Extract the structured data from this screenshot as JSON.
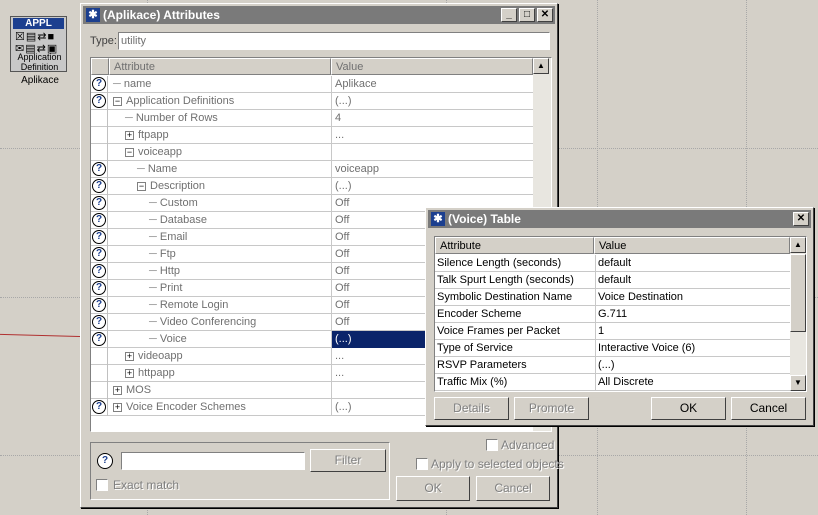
{
  "desktop": {
    "node": {
      "badge": "APPL",
      "line1": "Application",
      "line2": "Definition",
      "caption": "Aplikace"
    }
  },
  "attributes_window": {
    "title": "(Aplikace) Attributes",
    "type_label": "Type:",
    "type_value": "utility",
    "columns": {
      "attribute": "Attribute",
      "value": "Value"
    },
    "rows": [
      {
        "label": "name",
        "value": "Aplikace",
        "help": true,
        "indent": 0,
        "expander": ""
      },
      {
        "label": "Application Definitions",
        "value": "(...)",
        "help": true,
        "indent": 0,
        "expander": "−"
      },
      {
        "label": "Number of Rows",
        "value": "4",
        "help": false,
        "indent": 1,
        "expander": ""
      },
      {
        "label": "ftpapp",
        "value": "...",
        "help": false,
        "indent": 1,
        "expander": "+"
      },
      {
        "label": "voiceapp",
        "value": "",
        "help": false,
        "indent": 1,
        "expander": "−"
      },
      {
        "label": "Name",
        "value": "voiceapp",
        "help": true,
        "indent": 2,
        "expander": ""
      },
      {
        "label": "Description",
        "value": "(...)",
        "help": true,
        "indent": 2,
        "expander": "−"
      },
      {
        "label": "Custom",
        "value": "Off",
        "help": true,
        "indent": 3,
        "expander": ""
      },
      {
        "label": "Database",
        "value": "Off",
        "help": true,
        "indent": 3,
        "expander": ""
      },
      {
        "label": "Email",
        "value": "Off",
        "help": true,
        "indent": 3,
        "expander": ""
      },
      {
        "label": "Ftp",
        "value": "Off",
        "help": true,
        "indent": 3,
        "expander": ""
      },
      {
        "label": "Http",
        "value": "Off",
        "help": true,
        "indent": 3,
        "expander": ""
      },
      {
        "label": "Print",
        "value": "Off",
        "help": true,
        "indent": 3,
        "expander": ""
      },
      {
        "label": "Remote Login",
        "value": "Off",
        "help": true,
        "indent": 3,
        "expander": ""
      },
      {
        "label": "Video Conferencing",
        "value": "Off",
        "help": true,
        "indent": 3,
        "expander": ""
      },
      {
        "label": "Voice",
        "value": "(...)",
        "help": true,
        "indent": 3,
        "expander": "",
        "selected": true
      },
      {
        "label": "videoapp",
        "value": "...",
        "help": false,
        "indent": 1,
        "expander": "+"
      },
      {
        "label": "httpapp",
        "value": "...",
        "help": false,
        "indent": 1,
        "expander": "+"
      },
      {
        "label": "MOS",
        "value": "",
        "help": false,
        "indent": 0,
        "expander": "+"
      },
      {
        "label": "Voice Encoder Schemes",
        "value": "(...)",
        "help": true,
        "indent": 0,
        "expander": "+"
      }
    ],
    "filter_button": "Filter",
    "exact_match_label": "Exact match",
    "advanced_label": "Advanced",
    "apply_selected_label": "Apply to selected objects",
    "ok_button": "OK",
    "cancel_button": "Cancel"
  },
  "voice_window": {
    "title": "(Voice) Table",
    "columns": {
      "attribute": "Attribute",
      "value": "Value"
    },
    "rows": [
      {
        "label": "Silence Length (seconds)",
        "value": "default"
      },
      {
        "label": "Talk Spurt Length (seconds)",
        "value": "default"
      },
      {
        "label": "Symbolic Destination Name",
        "value": "Voice Destination"
      },
      {
        "label": "Encoder Scheme",
        "value": "G.711"
      },
      {
        "label": "Voice Frames per Packet",
        "value": "1"
      },
      {
        "label": "Type of Service",
        "value": "Interactive Voice (6)"
      },
      {
        "label": "RSVP Parameters",
        "value": "(...)"
      },
      {
        "label": "Traffic Mix (%)",
        "value": "All Discrete"
      }
    ],
    "details_button": "Details",
    "promote_button": "Promote",
    "ok_button": "OK",
    "cancel_button": "Cancel"
  }
}
